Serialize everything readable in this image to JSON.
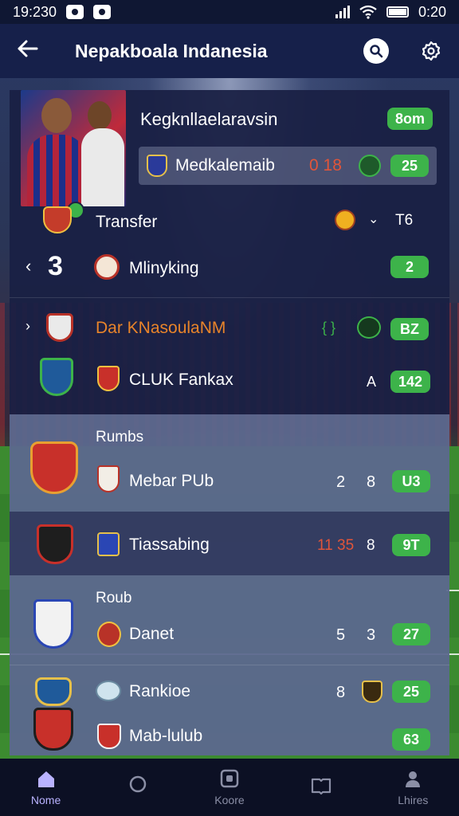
{
  "status_bar": {
    "time_left": "19:230",
    "time_right": "0:20"
  },
  "app_bar": {
    "title": "Nepakboala Indanesia"
  },
  "profile": {
    "title": "Kegknllaelaravsin",
    "badge": "8om"
  },
  "highlight_row": {
    "name": "Medkalemaib",
    "score": "0 18",
    "pill": "25"
  },
  "transfer_row": {
    "label": "Transfer",
    "extra": "T6"
  },
  "rows": [
    {
      "prefix": "3",
      "name": "Mlinyking",
      "pill": "2"
    },
    {
      "name": "Dar KNasoulaNM",
      "pill": "BZ"
    },
    {
      "name": "CLUK Fankax",
      "mid": "A",
      "pill": "142"
    }
  ],
  "section_rumbs": {
    "header": "Rumbs",
    "row": {
      "name": "Mebar PUb",
      "n1": "2",
      "n2": "8",
      "pill": "U3"
    }
  },
  "highlighted_tassabing": {
    "name": "Tiassabing",
    "score": "11 35",
    "n2": "8",
    "pill": "9T"
  },
  "section_roub": {
    "header": "Roub",
    "rows": [
      {
        "name": "Danet",
        "n1": "5",
        "n2": "3",
        "pill": "27"
      },
      {
        "name": "Rankioe",
        "n1": "8",
        "pill": "25"
      },
      {
        "name": "Mab-lulub",
        "pill": "63"
      }
    ]
  },
  "bottom_nav": [
    {
      "label": "Nome",
      "icon": "home-icon",
      "active": true
    },
    {
      "label": "",
      "icon": "circle-icon",
      "active": false
    },
    {
      "label": "Koore",
      "icon": "square-icon",
      "active": false
    },
    {
      "label": "",
      "icon": "book-icon",
      "active": false
    },
    {
      "label": "Lhires",
      "icon": "person-icon",
      "active": false
    }
  ],
  "colors": {
    "accent_green": "#3db34a",
    "score_red": "#e0553a",
    "nav_active": "#b9b2ff"
  }
}
